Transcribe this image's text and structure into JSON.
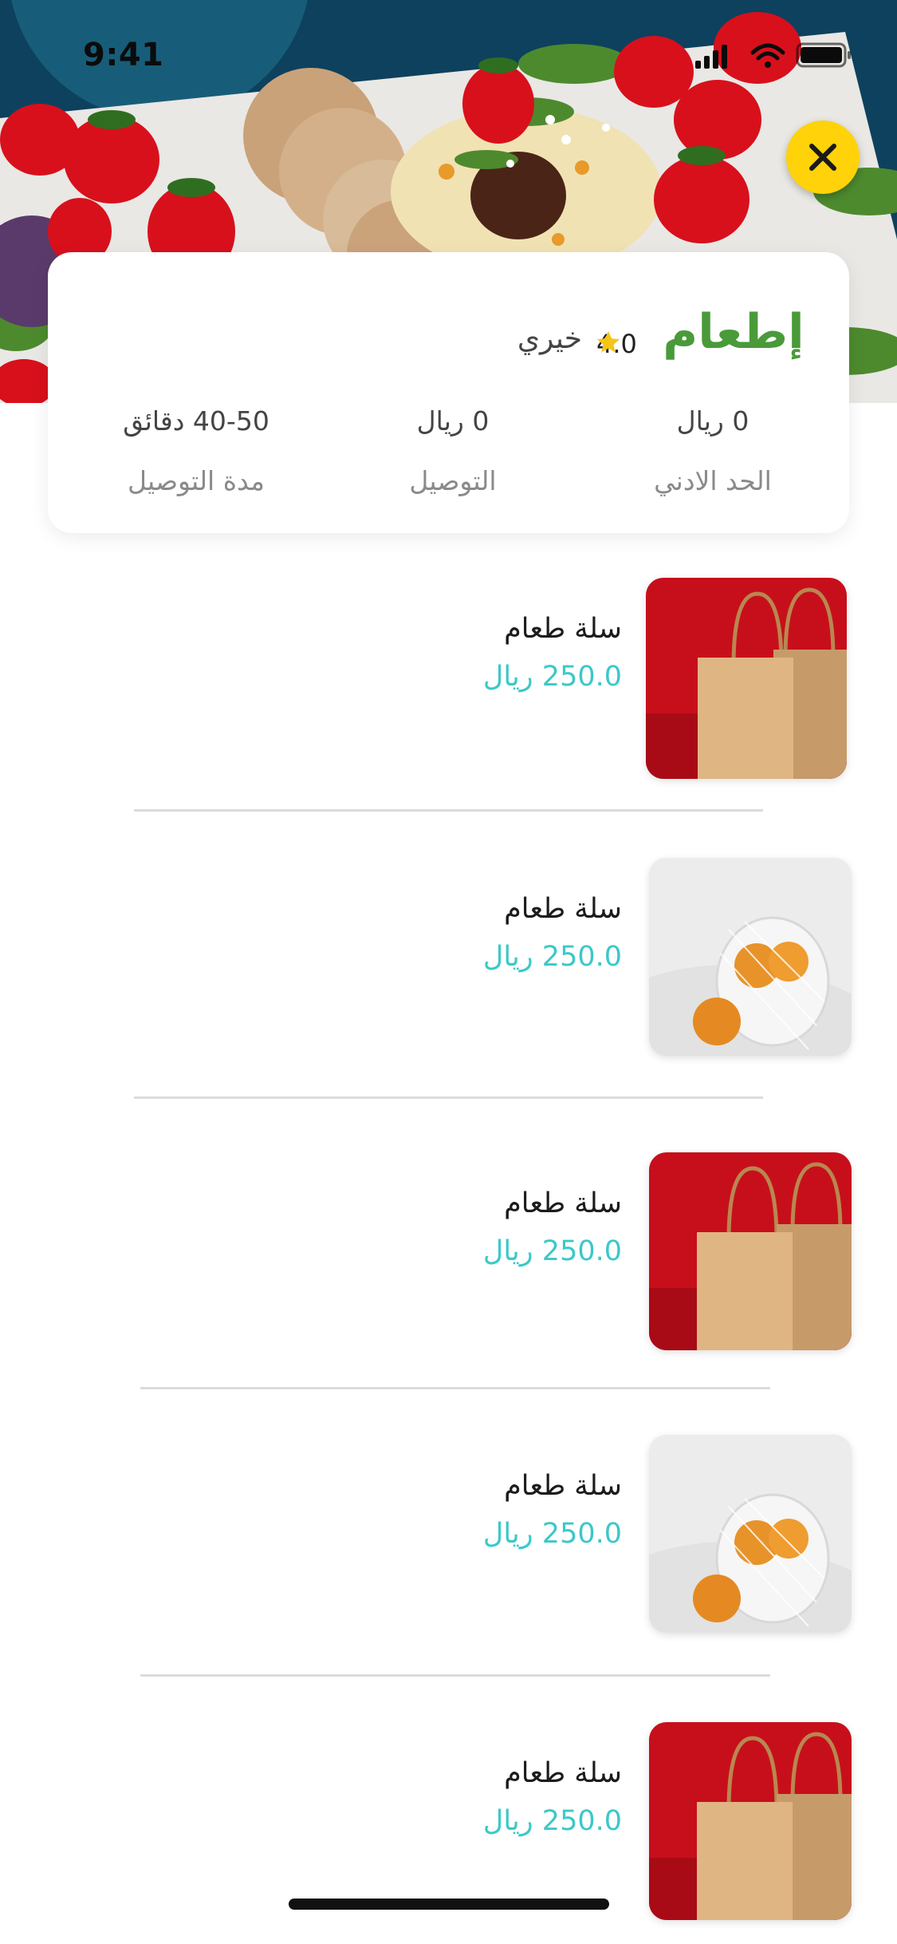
{
  "status_bar": {
    "time": "9:41"
  },
  "store": {
    "name": "خيري",
    "rating": "4.0",
    "logo_text": "إطعام",
    "stats": [
      {
        "value": "0 ريال",
        "label": "الحد الادني"
      },
      {
        "value": "0 ريال",
        "label": "التوصيل"
      },
      {
        "value": "40-50 دقائق",
        "label": "مدة التوصيل"
      }
    ]
  },
  "products": [
    {
      "name": "سلة طعام",
      "price": "250.0 ريال",
      "image": "paper-bags-red"
    },
    {
      "name": "سلة طعام",
      "price": "250.0 ريال",
      "image": "oranges-net-bag"
    },
    {
      "name": "سلة طعام",
      "price": "250.0 ريال",
      "image": "paper-bags-red"
    },
    {
      "name": "سلة طعام",
      "price": "250.0 ريال",
      "image": "oranges-net-bag"
    },
    {
      "name": "سلة طعام",
      "price": "250.0 ريال",
      "image": "paper-bags-red"
    }
  ],
  "colors": {
    "accent": "#ffd20a",
    "price": "#3cc8c8",
    "star": "#f5c518",
    "logo_green": "#4a9a3a"
  },
  "icons": {
    "close": "close-icon",
    "star": "star-icon",
    "signal": "signal-icon",
    "wifi": "wifi-icon",
    "battery": "battery-icon"
  }
}
